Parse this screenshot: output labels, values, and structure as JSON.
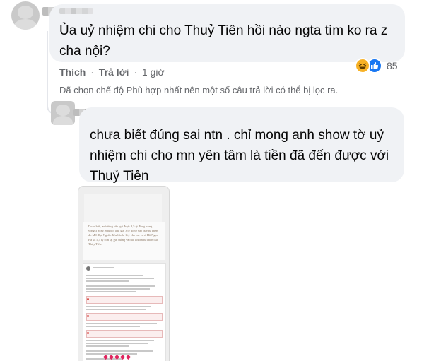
{
  "comment1": {
    "lines": [
      "Ủa uỷ nhiệm chi cho Thuỷ Tiên hồi nào ngta tìm ko ra z",
      "cha nội?"
    ],
    "actions": {
      "like_label": "Thích",
      "reply_label": "Trả lời",
      "separator": "·",
      "time": "1 giờ"
    },
    "reactions": {
      "icons": [
        "haha-icon",
        "like-icon"
      ],
      "count": "85",
      "colors": {
        "haha": "#f7b125",
        "like": "#1877f2"
      }
    }
  },
  "filter_notice": "Đã chọn chế độ Phù hợp nhất nên một số câu trả lời có thể bị lọc ra.",
  "comment2": {
    "lines": [
      "chưa biết đúng sai ntn . chỉ mong anh show tờ uỷ",
      "nhiệm chi cho mn yên tâm là tiền đã đến được với",
      "Thuỷ Tiên"
    ],
    "attachment": {
      "caption": "Doan biết, anh từng kêu gọi được 8,5 tỷ đồng trong vòng 3 ngày. Sau đó, anh gửi 3 tỷ đồng vào quỹ từ thiện do MC Đại Nghĩa điều hành, 1 tỷ cho mẹ ca sĩ Hồ Ngọc Hà và 4,5 tỷ còn lại gửi thẳng vào tài khoản từ thiện của Thủy Tiên."
    }
  },
  "colors": {
    "bubble": "#f0f2f5",
    "meta_text": "#65676b",
    "text": "#050505"
  }
}
